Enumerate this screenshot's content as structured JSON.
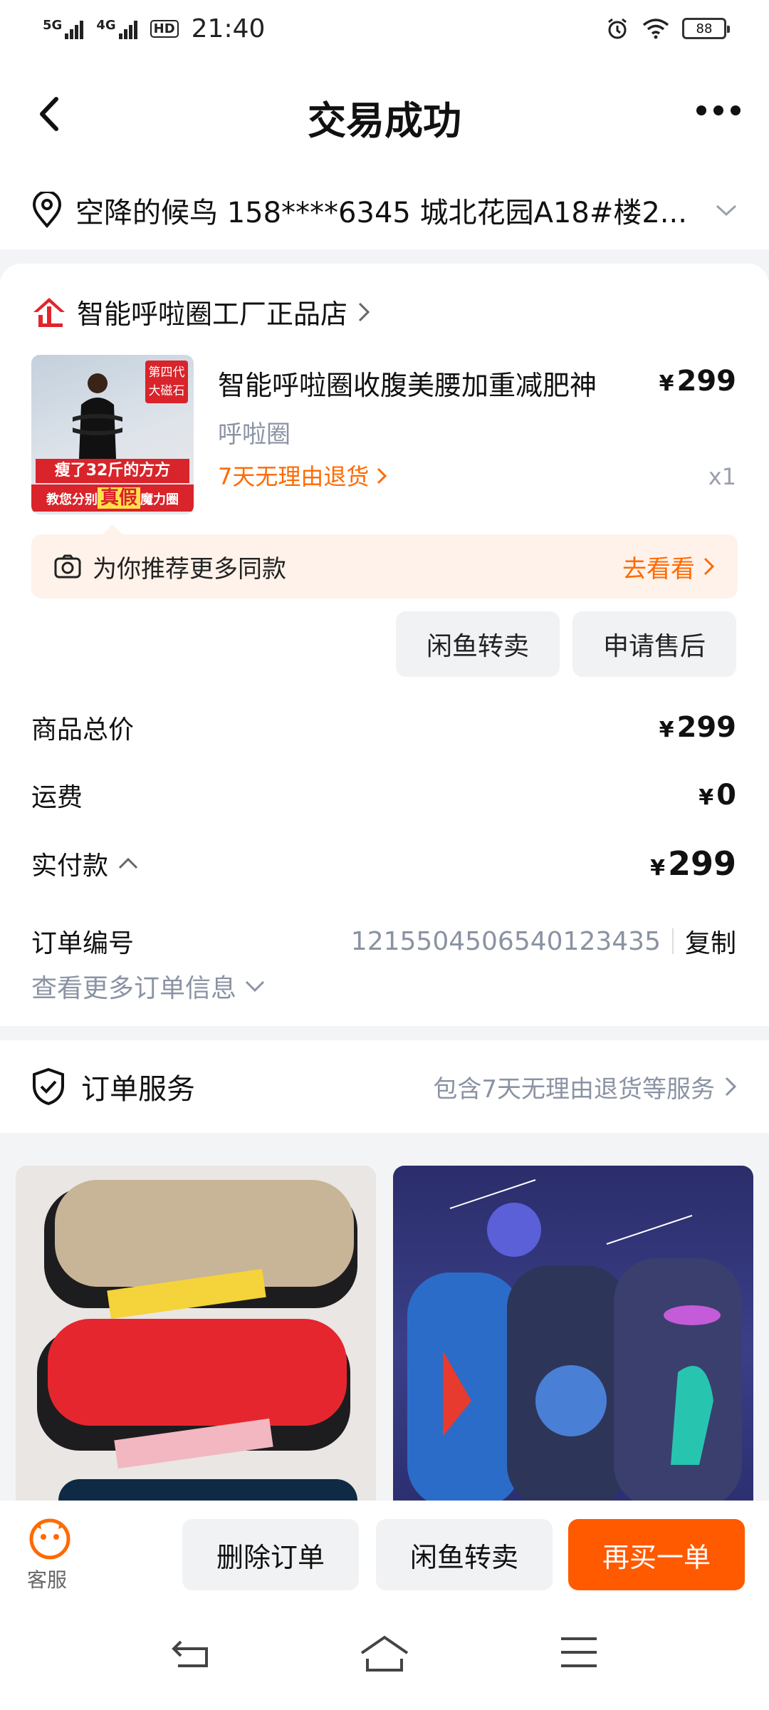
{
  "status_bar": {
    "signal1_label": "5G",
    "signal2_label": "4G",
    "hd_label": "HD",
    "time": "21:40",
    "battery": "88"
  },
  "header": {
    "title": "交易成功",
    "back_icon": "chevron-left-icon",
    "more_icon": "more-dots-icon"
  },
  "address": {
    "text": "空降的候鸟  158****6345  城北花园A18#楼2..."
  },
  "shop": {
    "name": "智能呼啦圈工厂正品店",
    "logo_icon": "enterprise-icon"
  },
  "product": {
    "title": "智能呼啦圈收腹美腰加重减肥神",
    "price_symbol": "¥",
    "price": "299",
    "spec": "呼啦圈",
    "return_policy": "7天无理由退货",
    "quantity": "x1",
    "image_tag": "第四代 大磁石",
    "image_band1": "瘦了32斤的方方",
    "image_band2_pre": "教您分别",
    "image_band2_highlight": "真假",
    "image_band2_post": "魔力圈"
  },
  "recommend": {
    "text": "为你推荐更多同款",
    "link": "去看看"
  },
  "actions": {
    "resell": "闲鱼转卖",
    "after_sale": "申请售后"
  },
  "fees": {
    "total_label": "商品总价",
    "total_value": "299",
    "shipping_label": "运费",
    "shipping_value": "0",
    "paid_label": "实付款",
    "paid_value": "299",
    "currency": "¥"
  },
  "order": {
    "number_label": "订单编号",
    "number": "1215504506540123435",
    "copy": "复制",
    "more_info": "查看更多订单信息"
  },
  "service": {
    "title": "订单服务",
    "desc": "包含7天无理由退货等服务"
  },
  "bottom_bar": {
    "customer_service": "客服",
    "delete": "删除订单",
    "resell": "闲鱼转卖",
    "rebuy": "再买一单"
  },
  "colors": {
    "accent": "#ff5a00",
    "muted": "#8a93a3"
  }
}
